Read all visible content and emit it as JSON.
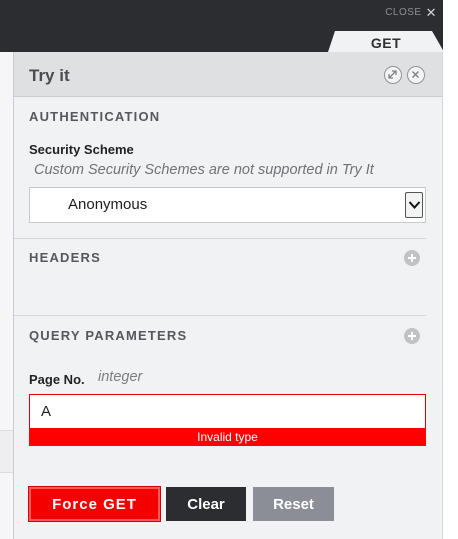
{
  "topbar": {
    "close_label": "CLOSE",
    "close_icon": "close-x-icon"
  },
  "method_tab": {
    "label": "GET"
  },
  "panel": {
    "title": "Try it",
    "header_icons": [
      "expand-icon",
      "close-circle-icon"
    ]
  },
  "authentication": {
    "section_title": "AUTHENTICATION",
    "security_scheme_label": "Security Scheme",
    "note": "Custom Security Schemes are not supported in Try It",
    "selected_scheme": "Anonymous"
  },
  "headers": {
    "section_title": "HEADERS",
    "add_icon": "plus-circle-icon"
  },
  "query_parameters": {
    "section_title": "QUERY PARAMETERS",
    "add_icon": "plus-circle-icon",
    "params": [
      {
        "name": "Page No.",
        "type": "integer",
        "value": "A",
        "error": "Invalid type"
      }
    ]
  },
  "actions": {
    "force_label": "Force GET",
    "clear_label": "Clear",
    "reset_label": "Reset"
  },
  "colors": {
    "error": "#ff0000",
    "dark": "#2b2d31",
    "muted_button": "#8b8e96"
  }
}
